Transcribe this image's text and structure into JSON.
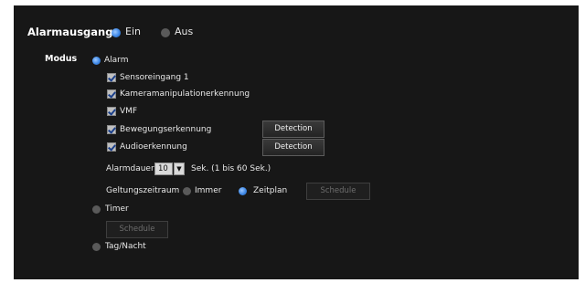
{
  "alarm_output": {
    "label": "Alarmausgang",
    "on_label": "Ein",
    "off_label": "Aus"
  },
  "mode": {
    "label": "Modus",
    "alarm_label": "Alarm",
    "sources": [
      {
        "label": "Sensoreingang 1",
        "checked": true
      },
      {
        "label": "Kameramanipulationerkennung",
        "checked": true
      },
      {
        "label": "VMF",
        "checked": true
      },
      {
        "label": "Bewegungserkennung",
        "checked": true
      },
      {
        "label": "Audioerkennung",
        "checked": true
      }
    ],
    "detection_button": "Detection",
    "duration": {
      "label": "Alarmdauer",
      "value": "10",
      "suffix": "Sek. (1 bis 60 Sek.)"
    },
    "validity": {
      "label": "Geltungszeitraum",
      "always_label": "Immer",
      "schedule_label": "Zeitplan",
      "schedule_button": "Schedule"
    },
    "timer_label": "Timer",
    "timer_schedule_button": "Schedule",
    "daynight_label": "Tag/Nacht"
  }
}
